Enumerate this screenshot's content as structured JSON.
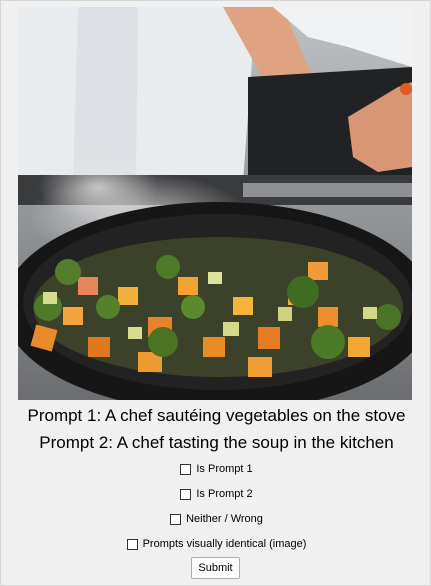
{
  "image": {
    "description_icon": "photo-chef-sauteing-vegetables"
  },
  "prompts": {
    "prompt1": "Prompt 1: A chef sautéing vegetables on the stove",
    "prompt2": "Prompt 2: A chef tasting the soup in the kitchen"
  },
  "options": [
    {
      "label": "Is Prompt 1",
      "checked": false
    },
    {
      "label": "Is Prompt 2",
      "checked": false
    },
    {
      "label": "Neither / Wrong",
      "checked": false
    },
    {
      "label": "Prompts visually identical (image)",
      "checked": false
    }
  ],
  "submit_label": "Submit",
  "colors": {
    "background": "#f0f0f0",
    "pan": "#1c1c1c"
  }
}
